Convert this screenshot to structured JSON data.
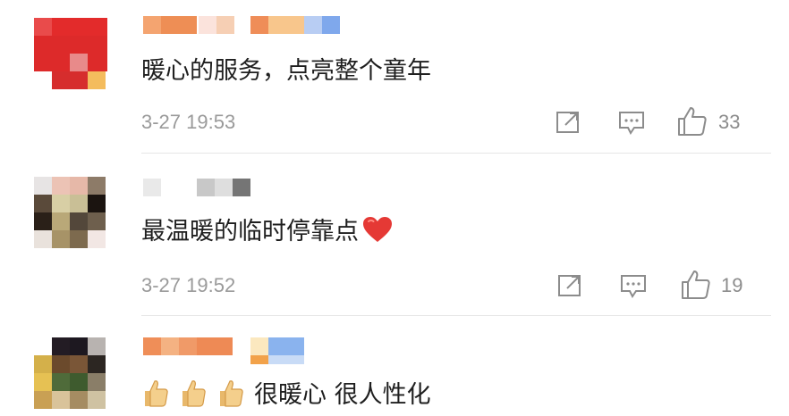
{
  "comments": [
    {
      "text": "暖心的服务，点亮整个童年",
      "timestamp": "3-27 19:53",
      "likes": "33",
      "icons": {
        "share": "share-icon",
        "reply": "reply-icon",
        "like": "thumb-up-icon"
      }
    },
    {
      "text": "最温暖的临时停靠点",
      "timestamp": "3-27 19:52",
      "likes": "19",
      "emoji": "red-heart-icon",
      "icons": {
        "share": "share-icon",
        "reply": "reply-icon",
        "like": "thumb-up-icon"
      }
    },
    {
      "text": "很暖心 很人性化",
      "emoji": "thumbs-up-emoji"
    }
  ],
  "colors": {
    "timestamp": "#9a9a9a",
    "icon": "#8c8c8c",
    "divider": "#e6e6e6"
  }
}
